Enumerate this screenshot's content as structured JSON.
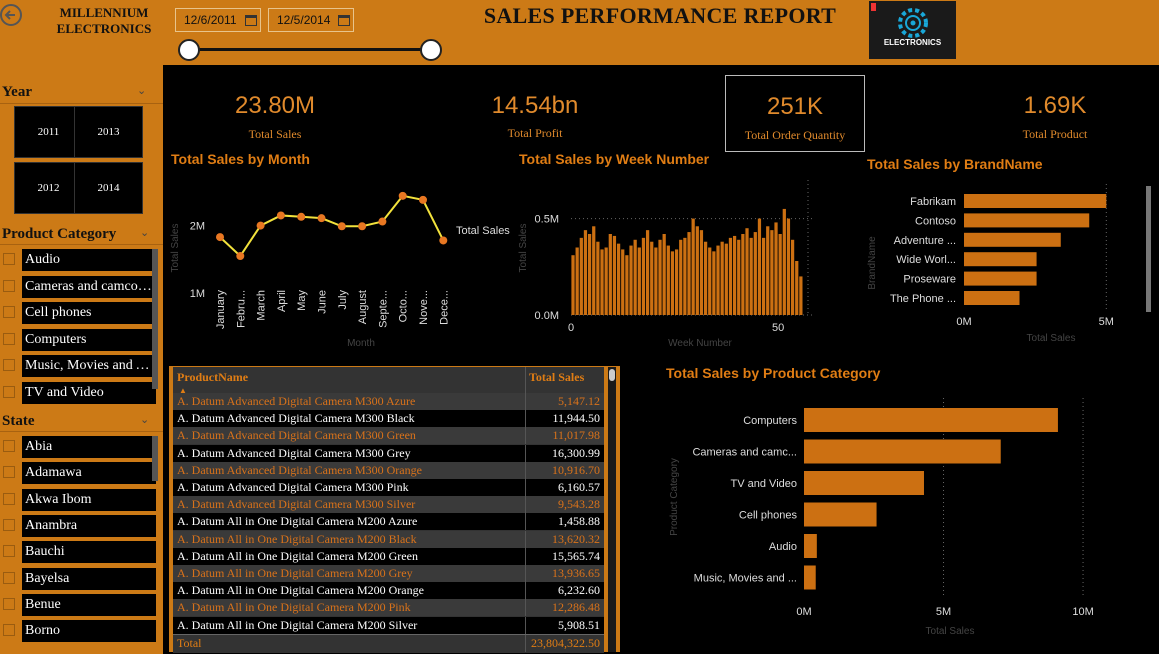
{
  "header": {
    "brand": "MILLENNIUM ELECTRONICS",
    "start_date": "12/6/2011",
    "end_date": "12/5/2014",
    "title": "SALES PERFORMANCE REPORT",
    "logo_text": "ELECTRONICS"
  },
  "filters": {
    "year_title": "Year",
    "years": [
      "2011",
      "2013",
      "2012",
      "2014"
    ],
    "category_title": "Product Category",
    "categories": [
      "Audio",
      "Cameras and camcorders",
      "Cell phones",
      "Computers",
      "Music, Movies and Audio Books",
      "TV and Video"
    ],
    "state_title": "State",
    "states": [
      "Abia",
      "Adamawa",
      "Akwa Ibom",
      "Anambra",
      "Bauchi",
      "Bayelsa",
      "Benue",
      "Borno"
    ]
  },
  "kpis": [
    {
      "value": "23.80M",
      "label": "Total Sales"
    },
    {
      "value": "14.54bn",
      "label": "Total Profit"
    },
    {
      "value": "251K",
      "label": "Total Order Quantity"
    },
    {
      "value": "1.69K",
      "label": "Total Product"
    }
  ],
  "colors": {
    "accent": "#cc7a16",
    "bar": "#cc7012",
    "line": "#f2e23c",
    "marker": "#e87722"
  },
  "chart_data": [
    {
      "type": "line",
      "title": "Total Sales by Month",
      "xlabel": "Month",
      "ylabel": "Total Sales",
      "series_label": "Total Sales",
      "categories": [
        "January",
        "February",
        "March",
        "April",
        "May",
        "June",
        "July",
        "August",
        "September",
        "October",
        "November",
        "December"
      ],
      "category_labels": [
        "January",
        "Febru...",
        "March",
        "April",
        "May",
        "June",
        "July",
        "August",
        "Septe...",
        "Octo...",
        "Nove...",
        "Dece..."
      ],
      "values": [
        1.83,
        1.55,
        2.0,
        2.15,
        2.13,
        2.11,
        1.99,
        1.99,
        2.06,
        2.44,
        2.38,
        1.78
      ],
      "yticks": [
        {
          "v": 1,
          "label": "1M"
        },
        {
          "v": 2,
          "label": "2M"
        }
      ],
      "ylim": [
        0.9,
        2.6
      ]
    },
    {
      "type": "bar",
      "title": "Total Sales by Week Number",
      "xlabel": "Week Number",
      "ylabel": "Total Sales",
      "values": [
        0.31,
        0.35,
        0.4,
        0.44,
        0.42,
        0.46,
        0.38,
        0.34,
        0.35,
        0.42,
        0.41,
        0.37,
        0.34,
        0.31,
        0.36,
        0.39,
        0.35,
        0.4,
        0.44,
        0.38,
        0.35,
        0.39,
        0.42,
        0.36,
        0.33,
        0.34,
        0.39,
        0.4,
        0.43,
        0.5,
        0.46,
        0.44,
        0.38,
        0.35,
        0.33,
        0.36,
        0.38,
        0.37,
        0.4,
        0.41,
        0.39,
        0.42,
        0.45,
        0.4,
        0.43,
        0.5,
        0.4,
        0.46,
        0.44,
        0.48,
        0.42,
        0.55,
        0.5,
        0.39,
        0.28,
        0.2
      ],
      "xticks": [
        {
          "v": 0,
          "label": "0"
        },
        {
          "v": 50,
          "label": "50"
        }
      ],
      "yticks": [
        {
          "v": 0,
          "label": "0.0M"
        },
        {
          "v": 0.5,
          "label": "0.5M"
        }
      ],
      "ylim": [
        0,
        0.7
      ]
    },
    {
      "type": "bar",
      "orientation": "horizontal",
      "title": "Total Sales by BrandName",
      "xlabel": "Total Sales",
      "ylabel": "BrandName",
      "categories": [
        "Fabrikam",
        "Contoso",
        "Wide World Importers",
        "Wide World Importers",
        "Proseware",
        "The Phone Company"
      ],
      "category_labels": [
        "Fabrikam",
        "Contoso",
        "Adventure ...",
        "Wide Worl...",
        "Proseware",
        "The Phone ..."
      ],
      "values": [
        5.0,
        4.4,
        3.4,
        2.55,
        2.55,
        1.95
      ],
      "xticks": [
        {
          "v": 0,
          "label": "0M"
        },
        {
          "v": 5,
          "label": "5M"
        }
      ],
      "xlim": [
        0,
        5.2
      ]
    },
    {
      "type": "bar",
      "orientation": "horizontal",
      "title": "Total Sales by Product Category",
      "xlabel": "Total Sales",
      "ylabel": "Product Category",
      "categories": [
        "Computers",
        "Cameras and camcorders",
        "TV and Video",
        "Cell phones",
        "Audio",
        "Music, Movies and Audio Books"
      ],
      "category_labels": [
        "Computers",
        "Cameras and camc...",
        "TV and Video",
        "Cell phones",
        "Audio",
        "Music, Movies and ..."
      ],
      "values": [
        9.1,
        7.05,
        4.3,
        2.6,
        0.46,
        0.42
      ],
      "xticks": [
        {
          "v": 0,
          "label": "0M"
        },
        {
          "v": 5,
          "label": "5M"
        },
        {
          "v": 10,
          "label": "10M"
        }
      ],
      "xlim": [
        0,
        10.5
      ]
    }
  ],
  "table": {
    "columns": [
      "ProductName",
      "Total Sales"
    ],
    "rows": [
      [
        "A. Datum Advanced Digital Camera M300 Azure",
        "5,147.12"
      ],
      [
        "A. Datum Advanced Digital Camera M300 Black",
        "11,944.50"
      ],
      [
        "A. Datum Advanced Digital Camera M300 Green",
        "11,017.98"
      ],
      [
        "A. Datum Advanced Digital Camera M300 Grey",
        "16,300.99"
      ],
      [
        "A. Datum Advanced Digital Camera M300 Orange",
        "10,916.70"
      ],
      [
        "A. Datum Advanced Digital Camera M300 Pink",
        "6,160.57"
      ],
      [
        "A. Datum Advanced Digital Camera M300 Silver",
        "9,543.28"
      ],
      [
        "A. Datum All in One Digital Camera M200 Azure",
        "1,458.88"
      ],
      [
        "A. Datum All in One Digital Camera M200 Black",
        "13,620.32"
      ],
      [
        "A. Datum All in One Digital Camera M200 Green",
        "15,565.74"
      ],
      [
        "A. Datum All in One Digital Camera M200 Grey",
        "13,936.65"
      ],
      [
        "A. Datum All in One Digital Camera M200 Orange",
        "6,232.60"
      ],
      [
        "A. Datum All in One Digital Camera M200 Pink",
        "12,286.48"
      ],
      [
        "A. Datum All in One Digital Camera M200 Silver",
        "5,908.51"
      ]
    ],
    "total_label": "Total",
    "total_value": "23,804,322.50"
  }
}
